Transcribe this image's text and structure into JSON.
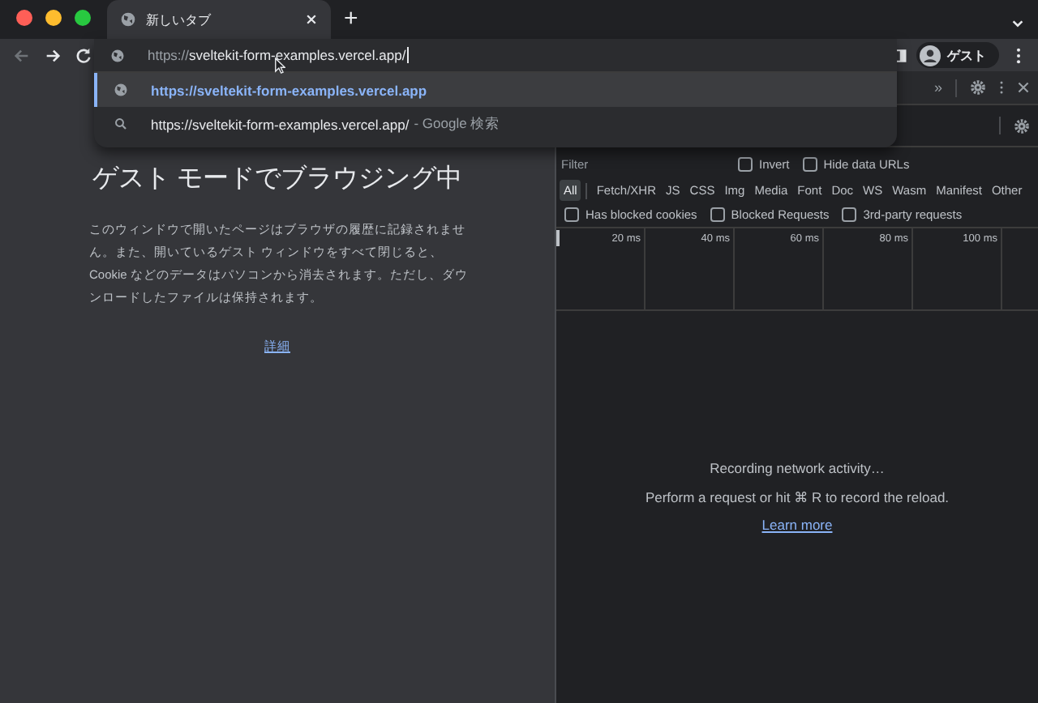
{
  "tabs": [
    {
      "title": "新しいタブ",
      "selected": true
    }
  ],
  "new_tab_button": "+",
  "omnibox": {
    "scheme": "https://",
    "value": "sveltekit-form-examples.vercel.app/"
  },
  "suggestions": [
    {
      "kind": "url",
      "text": "https://sveltekit-form-examples.vercel.app",
      "selected": true
    },
    {
      "kind": "search",
      "text": "https://sveltekit-form-examples.vercel.app/",
      "suffix": "- Google 検索",
      "selected": false
    }
  ],
  "profile": {
    "label": "ゲスト"
  },
  "page": {
    "heading": "ゲスト モードでブラウジング中",
    "body": "このウィンドウで開いたページはブラウザの履歴に記録されません。また、開いているゲスト ウィンドウをすべて閉じると、Cookie などのデータはパソコンから消去されます。ただし、ダウンロードしたファイルは保持されます。",
    "link": "詳細"
  },
  "devtools": {
    "more_tabs": "»",
    "filter": {
      "placeholder": "Filter"
    },
    "options": [
      {
        "label": "Invert",
        "checked": false
      },
      {
        "label": "Hide data URLs",
        "checked": false
      }
    ],
    "types": [
      {
        "label": "All",
        "selected": true
      },
      {
        "label": "Fetch/XHR",
        "selected": false
      },
      {
        "label": "JS",
        "selected": false
      },
      {
        "label": "CSS",
        "selected": false
      },
      {
        "label": "Img",
        "selected": false
      },
      {
        "label": "Media",
        "selected": false
      },
      {
        "label": "Font",
        "selected": false
      },
      {
        "label": "Doc",
        "selected": false
      },
      {
        "label": "WS",
        "selected": false
      },
      {
        "label": "Wasm",
        "selected": false
      },
      {
        "label": "Manifest",
        "selected": false
      },
      {
        "label": "Other",
        "selected": false
      }
    ],
    "blocks": [
      {
        "label": "Has blocked cookies",
        "checked": false
      },
      {
        "label": "Blocked Requests",
        "checked": false
      },
      {
        "label": "3rd-party requests",
        "checked": false
      }
    ],
    "ticks": [
      "20 ms",
      "40 ms",
      "60 ms",
      "80 ms",
      "100 ms"
    ],
    "empty": {
      "title": "Recording network activity…",
      "hint": "Perform a request or hit ⌘ R to record the reload.",
      "link": "Learn more"
    }
  }
}
